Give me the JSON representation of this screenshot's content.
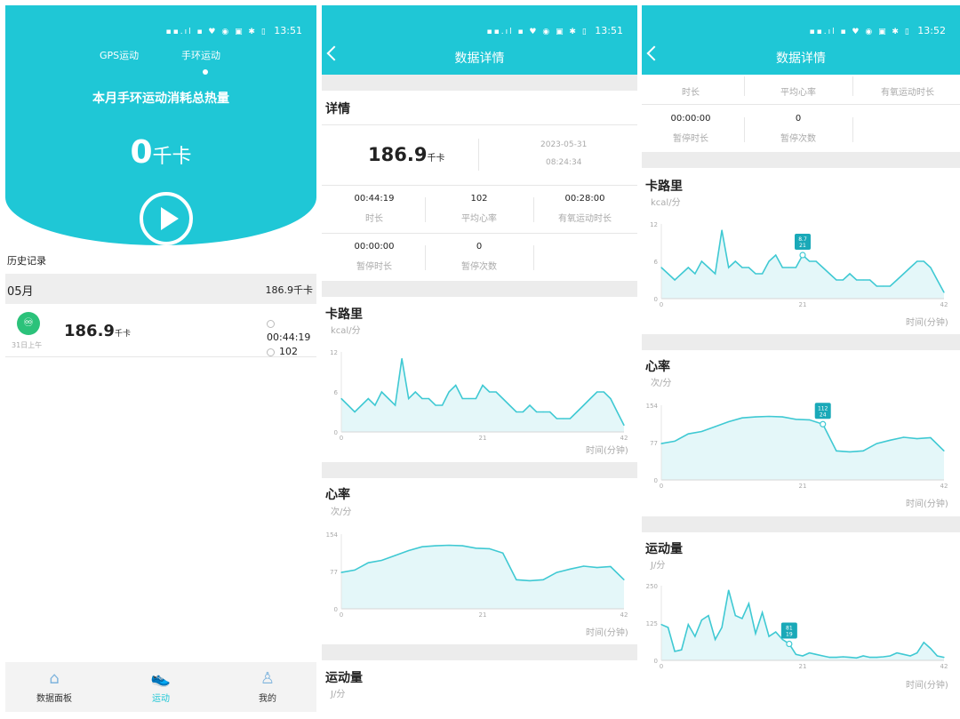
{
  "status_bar": {
    "time_1": "13:51",
    "time_2": "13:51",
    "time_3": "13:52"
  },
  "dashboard": {
    "tabs": [
      "GPS运动",
      "手环运动"
    ],
    "title": "本月手环运动消耗总热量",
    "kcal_value": "0",
    "kcal_unit": "千卡",
    "history_label": "历史记录",
    "month": "05月",
    "month_total": "186.9千卡",
    "record": {
      "date": "31日上午",
      "kcal": "186.9",
      "kcal_unit": "千卡",
      "duration": "00:44:19",
      "heart_rate": "102"
    },
    "nav": [
      {
        "label": "数据面板",
        "icon": "home-icon"
      },
      {
        "label": "运动",
        "icon": "running-shoe-icon"
      },
      {
        "label": "我的",
        "icon": "user-icon"
      }
    ]
  },
  "detail": {
    "title": "数据详情",
    "section_detail": "详情",
    "kcal": "186.9",
    "kcal_unit": "千卡",
    "date": "2023-05-31",
    "time": "08:24:34",
    "stats": [
      {
        "value": "00:44:19",
        "label": "时长"
      },
      {
        "value": "102",
        "label": "平均心率"
      },
      {
        "value": "00:28:00",
        "label": "有氧运动时长"
      },
      {
        "value": "00:00:00",
        "label": "暂停时长"
      },
      {
        "value": "0",
        "label": "暂停次数"
      }
    ],
    "calories": {
      "title": "卡路里",
      "unit": "kcal/分"
    },
    "heart": {
      "title": "心率",
      "unit": "次/分"
    },
    "activity": {
      "title": "运动量",
      "unit": "J/分"
    },
    "x_axis_label": "时间(分钟)"
  },
  "detail_scrolled": {
    "tooltip_cal": [
      "8.7",
      "21"
    ],
    "tooltip_hr": [
      "112",
      "24"
    ],
    "tooltip_act": [
      "81",
      "19"
    ]
  },
  "chart_data": [
    {
      "type": "area",
      "title": "卡路里",
      "ylabel": "kcal/分",
      "xlabel": "时间(分钟)",
      "ylim": [
        0,
        12
      ],
      "yticks": [
        "0",
        "6",
        "12"
      ],
      "xticks": [
        "0",
        "21",
        "42"
      ],
      "color": "#3fc9d3",
      "x": [
        0,
        1,
        2,
        3,
        4,
        5,
        6,
        7,
        8,
        9,
        10,
        11,
        12,
        13,
        14,
        15,
        16,
        17,
        18,
        19,
        20,
        21,
        22,
        23,
        24,
        25,
        26,
        27,
        28,
        29,
        30,
        31,
        32,
        33,
        34,
        35,
        36,
        37,
        38,
        39,
        40,
        41,
        42
      ],
      "values": [
        5,
        4,
        3,
        4,
        5,
        4,
        6,
        5,
        4,
        11,
        5,
        6,
        5,
        5,
        4,
        4,
        6,
        7,
        5,
        5,
        5,
        7,
        6,
        6,
        5,
        4,
        3,
        3,
        4,
        3,
        3,
        3,
        2,
        2,
        2,
        3,
        4,
        5,
        6,
        6,
        5,
        3,
        1
      ]
    },
    {
      "type": "area",
      "title": "心率",
      "ylabel": "次/分",
      "xlabel": "时间(分钟)",
      "ylim": [
        0,
        154
      ],
      "yticks": [
        "0",
        "77",
        "154"
      ],
      "xticks": [
        "0",
        "21",
        "42"
      ],
      "color": "#3fc9d3",
      "x": [
        0,
        2,
        4,
        6,
        8,
        10,
        12,
        14,
        16,
        18,
        20,
        22,
        24,
        26,
        28,
        30,
        32,
        34,
        36,
        38,
        40,
        42
      ],
      "values": [
        75,
        80,
        95,
        100,
        110,
        120,
        128,
        130,
        131,
        130,
        125,
        124,
        115,
        60,
        58,
        60,
        75,
        82,
        88,
        85,
        87,
        60
      ]
    },
    {
      "type": "area",
      "title": "运动量",
      "ylabel": "J/分",
      "xlabel": "时间(分钟)",
      "ylim": [
        0,
        250
      ],
      "yticks": [
        "0",
        "125",
        "250"
      ],
      "xticks": [
        "0",
        "21",
        "42"
      ],
      "color": "#3fc9d3",
      "x": [
        0,
        1,
        2,
        3,
        4,
        5,
        6,
        7,
        8,
        9,
        10,
        11,
        12,
        13,
        14,
        15,
        16,
        17,
        18,
        19,
        20,
        21,
        22,
        23,
        24,
        25,
        26,
        27,
        28,
        29,
        30,
        31,
        32,
        33,
        34,
        35,
        36,
        37,
        38,
        39,
        40,
        41,
        42
      ],
      "values": [
        120,
        110,
        30,
        35,
        120,
        80,
        135,
        150,
        70,
        110,
        235,
        150,
        140,
        190,
        90,
        160,
        80,
        95,
        70,
        55,
        20,
        15,
        25,
        20,
        15,
        10,
        10,
        12,
        10,
        8,
        15,
        10,
        10,
        12,
        15,
        25,
        20,
        15,
        25,
        60,
        40,
        15,
        10
      ]
    }
  ]
}
